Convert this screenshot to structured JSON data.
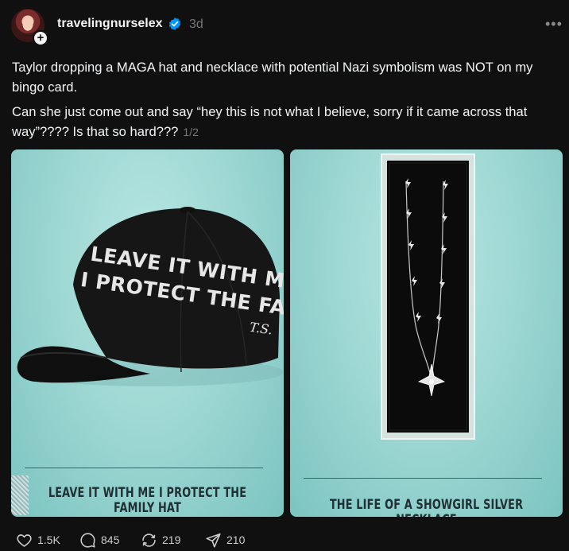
{
  "post": {
    "author": "travelingnurselex",
    "timestamp": "3d",
    "paragraph1": "Taylor dropping a MAGA hat and necklace with potential Nazi symbolism was NOT on my bingo card.",
    "paragraph2": "Can she just come out and say “hey this is not what I believe, sorry if it came across that way”???? Is that so hard???",
    "page_indicator": "1/2",
    "images": [
      {
        "caption": "LEAVE IT WITH ME I PROTECT THE FAMILY HAT",
        "hat_line1": "LEAVE IT WITH ME",
        "hat_line2": "I PROTECT THE FAMILY",
        "hat_side": "T.S."
      },
      {
        "caption": "THE LIFE OF A SHOWGIRL SILVER NECKLACE"
      }
    ],
    "actions": {
      "likes": "1.5K",
      "comments": "845",
      "reposts": "219",
      "shares": "210"
    },
    "icons": [
      "verified-icon",
      "follow-plus-icon",
      "more-icon",
      "heart-icon",
      "comment-icon",
      "repost-icon",
      "share-icon"
    ],
    "colors": {
      "background": "#101010",
      "verified": "#0095f6",
      "muted": "#777777",
      "image_bg": "#9fd8d4"
    }
  }
}
